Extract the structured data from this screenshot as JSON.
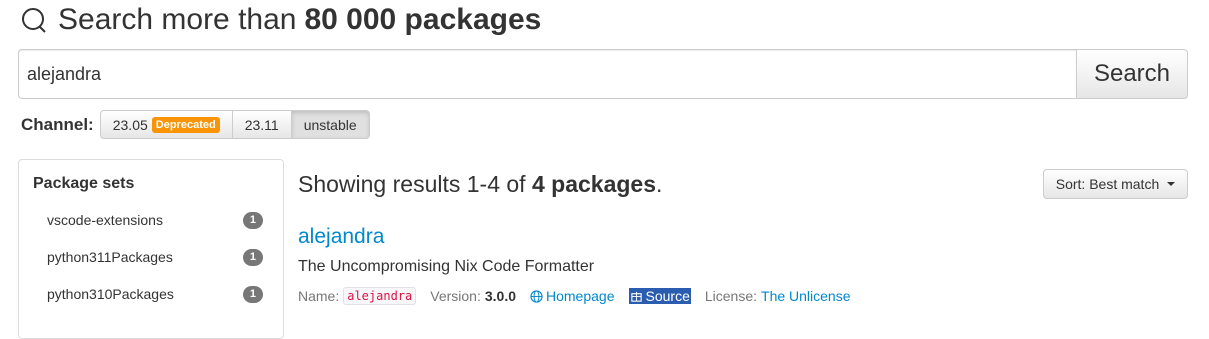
{
  "heading": {
    "prefix": "Search more than",
    "count": "80 000 packages"
  },
  "search": {
    "value": "alejandra",
    "button_label": "Search"
  },
  "channel": {
    "label": "Channel:",
    "options": [
      {
        "label": "23.05",
        "badge": "Deprecated"
      },
      {
        "label": "23.11"
      },
      {
        "label": "unstable"
      }
    ],
    "selected": "unstable"
  },
  "sidebar": {
    "title": "Package sets",
    "items": [
      {
        "label": "vscode-extensions",
        "count": "1"
      },
      {
        "label": "python311Packages",
        "count": "1"
      },
      {
        "label": "python310Packages",
        "count": "1"
      }
    ]
  },
  "results": {
    "prefix": "Showing results 1-4 of",
    "count": "4 packages",
    "suffix": ".",
    "sort_label": "Sort: Best match"
  },
  "package": {
    "name": "alejandra",
    "description": "The Uncompromising Nix Code Formatter",
    "name_label": "Name:",
    "name_value": "alejandra",
    "version_label": "Version:",
    "version_value": "3.0.0",
    "homepage_label": "Homepage",
    "source_label": "Source",
    "license_label": "License:",
    "license_value": "The Unlicense"
  },
  "colors": {
    "link": "#0088cc",
    "deprecated_badge": "#f89406",
    "count_badge": "#777777",
    "source_highlight": "#2a5db0"
  }
}
